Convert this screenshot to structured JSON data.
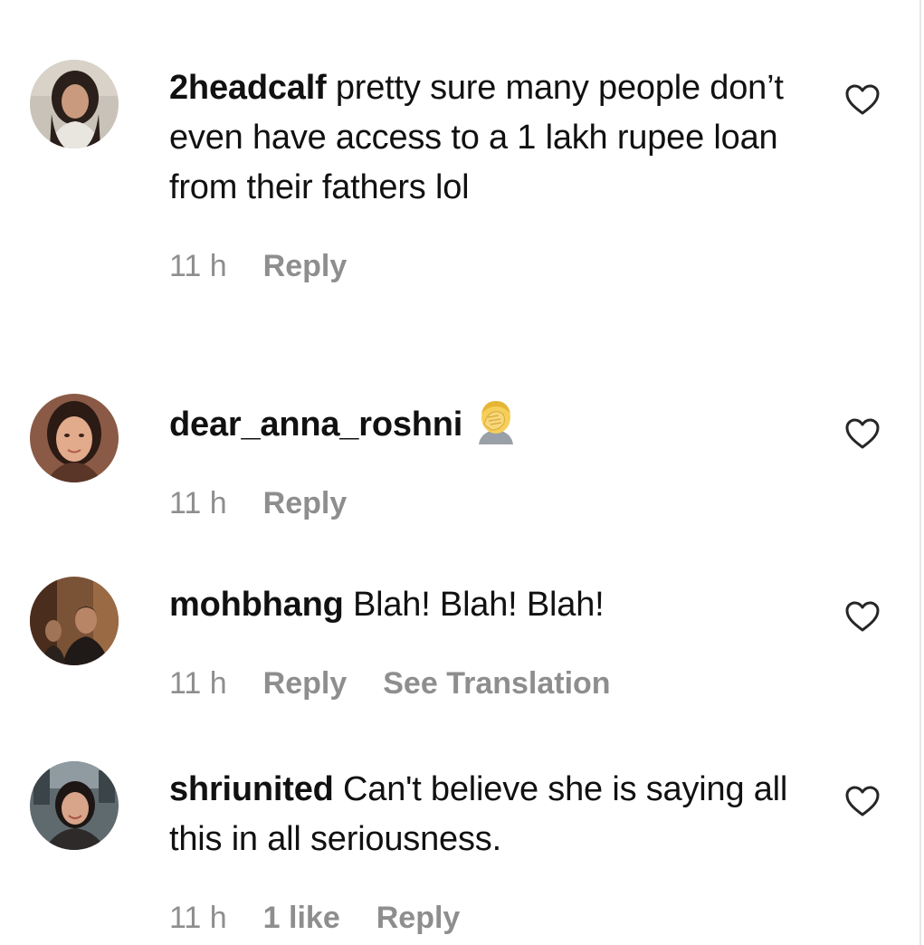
{
  "comments": [
    {
      "username": "2headcalf",
      "text": "pretty sure many people don’t even have access to a 1 lakh rupee loan from their fathers lol",
      "time": "11 h",
      "likes": "",
      "reply": "Reply",
      "translation": ""
    },
    {
      "username": "dear_anna_roshni",
      "text": "",
      "emoji": "face-palm-emoji",
      "time": "11 h",
      "likes": "",
      "reply": "Reply",
      "translation": ""
    },
    {
      "username": "mohbhang",
      "text": "Blah! Blah! Blah!",
      "time": "11 h",
      "likes": "",
      "reply": "Reply",
      "translation": "See Translation"
    },
    {
      "username": "shriunited",
      "text": "Can't believe she is saying all this in all seriousness.",
      "time": "11 h",
      "likes": "1 like",
      "reply": "Reply",
      "translation": ""
    }
  ],
  "colors": {
    "text": "#111111",
    "meta": "#8e8e8e",
    "icon": "#262626"
  }
}
